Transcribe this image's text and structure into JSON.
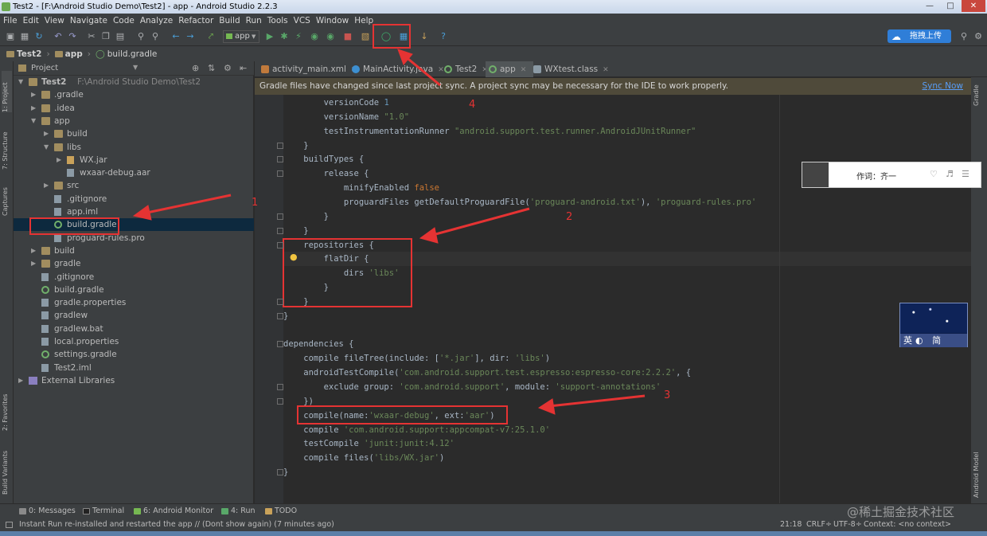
{
  "window": {
    "title": "Test2 - [F:\\Android Studio Demo\\Test2] - app - Android Studio 2.2.3",
    "upload_label": "拖拽上传"
  },
  "menu": [
    "File",
    "Edit",
    "View",
    "Navigate",
    "Code",
    "Analyze",
    "Refactor",
    "Build",
    "Run",
    "Tools",
    "VCS",
    "Window",
    "Help"
  ],
  "toolbar": {
    "run_config": "app"
  },
  "breadcrumb": [
    "Test2",
    "app",
    "build.gradle"
  ],
  "project_panel": {
    "view_label": "Project",
    "tree": [
      {
        "label": "Test2",
        "extra": "F:\\Android Studio Demo\\Test2",
        "icon": "folder-icon",
        "depth": 0,
        "expanded": true
      },
      {
        "label": ".gradle",
        "icon": "folder-icon",
        "depth": 1,
        "expanded": false
      },
      {
        "label": ".idea",
        "icon": "folder-icon",
        "depth": 1,
        "expanded": false
      },
      {
        "label": "app",
        "icon": "folder-icon",
        "depth": 1,
        "expanded": true
      },
      {
        "label": "build",
        "icon": "folder-icon",
        "depth": 2,
        "expanded": false
      },
      {
        "label": "libs",
        "icon": "folder-icon",
        "depth": 2,
        "expanded": true
      },
      {
        "label": "WX.jar",
        "icon": "jar-icon",
        "depth": 3,
        "expanded": false
      },
      {
        "label": "wxaar-debug.aar",
        "icon": "file-icon",
        "depth": 3
      },
      {
        "label": "src",
        "icon": "folder-icon",
        "depth": 2,
        "expanded": false
      },
      {
        "label": ".gitignore",
        "icon": "file-icon",
        "depth": 2
      },
      {
        "label": "app.iml",
        "icon": "file-icon",
        "depth": 2
      },
      {
        "label": "build.gradle",
        "icon": "gradle-icon",
        "depth": 2,
        "selected": true
      },
      {
        "label": "proguard-rules.pro",
        "icon": "file-icon",
        "depth": 2
      },
      {
        "label": "build",
        "icon": "folder-icon",
        "depth": 1,
        "expanded": false
      },
      {
        "label": "gradle",
        "icon": "folder-icon",
        "depth": 1,
        "expanded": false
      },
      {
        "label": ".gitignore",
        "icon": "file-icon",
        "depth": 1
      },
      {
        "label": "build.gradle",
        "icon": "gradle-icon",
        "depth": 1
      },
      {
        "label": "gradle.properties",
        "icon": "file-icon",
        "depth": 1
      },
      {
        "label": "gradlew",
        "icon": "file-icon",
        "depth": 1
      },
      {
        "label": "gradlew.bat",
        "icon": "file-icon",
        "depth": 1
      },
      {
        "label": "local.properties",
        "icon": "file-icon",
        "depth": 1
      },
      {
        "label": "settings.gradle",
        "icon": "gradle-icon",
        "depth": 1
      },
      {
        "label": "Test2.iml",
        "icon": "file-icon",
        "depth": 1
      },
      {
        "label": "External Libraries",
        "icon": "library-icon",
        "depth": 0,
        "expanded": false
      }
    ]
  },
  "editor_tabs": [
    {
      "label": "activity_main.xml",
      "active": false
    },
    {
      "label": "MainActivity.java",
      "active": false
    },
    {
      "label": "Test2",
      "active": false
    },
    {
      "label": "app",
      "active": true
    },
    {
      "label": "WXtest.class",
      "active": false
    }
  ],
  "notification": {
    "text": "Gradle files have changed since last project sync. A project sync may be necessary for the IDE to work properly.",
    "link": "Sync Now"
  },
  "code_lines": [
    "        versionCode 1",
    "        versionName \"1.0\"",
    "        testInstrumentationRunner \"android.support.test.runner.AndroidJUnitRunner\"",
    "    }",
    "    buildTypes {",
    "        release {",
    "            minifyEnabled false",
    "            proguardFiles getDefaultProguardFile('proguard-android.txt'), 'proguard-rules.pro'",
    "        }",
    "    }",
    "    repositories {",
    "        flatDir {",
    "            dirs 'libs'",
    "        }",
    "    }",
    "}",
    "",
    "dependencies {",
    "    compile fileTree(include: ['*.jar'], dir: 'libs')",
    "    androidTestCompile('com.android.support.test.espresso:espresso-core:2.2.2', {",
    "        exclude group: 'com.android.support', module: 'support-annotations'",
    "    })",
    "    compile(name:'wxaar-debug', ext:'aar')",
    "    compile 'com.android.support:appcompat-v7:25.1.0'",
    "    testCompile 'junit:junit:4.12'",
    "    compile files('libs/WX.jar')",
    "}"
  ],
  "annotations": [
    "1",
    "2",
    "3",
    "4"
  ],
  "side_tabs": {
    "left": [
      "1: Project",
      "7: Structure",
      "Captures",
      "2: Favorites",
      "Build Variants"
    ],
    "right": [
      "Gradle",
      "Android Model"
    ]
  },
  "bottom_tabs": [
    "0: Messages",
    "Terminal",
    "6: Android Monitor",
    "4: Run",
    "TODO"
  ],
  "status": {
    "message": "Instant Run re-installed and restarted the app // (Dont show again) (7 minutes ago)",
    "position": "21:18",
    "line_sep": "CRLF÷",
    "encoding": "UTF-8÷",
    "context": "Context: <no context>"
  },
  "overlays": {
    "lyric_text": "作词：齐一",
    "ime_text": "英◐ 简"
  },
  "watermark": "@稀土掘金技术社区",
  "colors": {
    "ide_bg": "#2b2b2b",
    "panel_bg": "#3c3f41",
    "selection": "#0d293e",
    "keyword": "#cc7832",
    "string": "#6a8759",
    "annotation_red": "#e53333"
  }
}
